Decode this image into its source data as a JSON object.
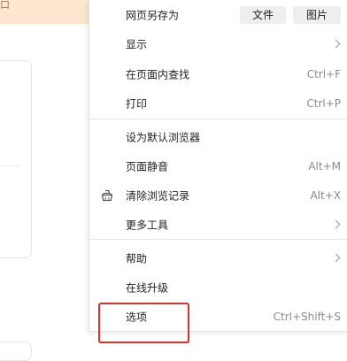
{
  "background": {
    "topbar_text": "口"
  },
  "menu": {
    "save_as": {
      "label": "网页另存为",
      "file_button": "文件",
      "image_button": "图片"
    },
    "display": {
      "label": "显示"
    },
    "find_in_page": {
      "label": "在页面内查找",
      "shortcut": "Ctrl+F"
    },
    "print": {
      "label": "打印",
      "shortcut": "Ctrl+P"
    },
    "set_default": {
      "label": "设为默认浏览器"
    },
    "mute_page": {
      "label": "页面静音",
      "shortcut": "Alt+M"
    },
    "clear_history": {
      "label": "清除浏览记录",
      "shortcut": "Alt+X",
      "icon": "cleaner-icon"
    },
    "more_tools": {
      "label": "更多工具"
    },
    "help": {
      "label": "帮助"
    },
    "online_upgrade": {
      "label": "在线升级"
    },
    "options": {
      "label": "选项",
      "shortcut": "Ctrl+Shift+S"
    }
  },
  "colors": {
    "topbar_bg": "#fde6cf",
    "highlight": "#d9322b",
    "separator": "#e6e6e6",
    "shortcut_text": "#8a8a8a"
  }
}
